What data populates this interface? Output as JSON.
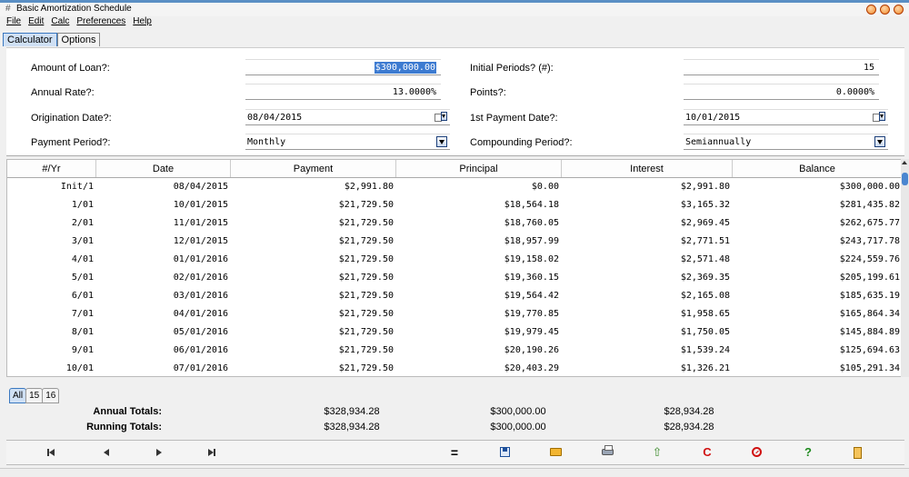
{
  "window": {
    "title": "Basic Amortization Schedule",
    "icon": "app-icon"
  },
  "menu": [
    "File",
    "Edit",
    "Calc",
    "Preferences",
    "Help"
  ],
  "tabs": [
    "Calculator",
    "Options"
  ],
  "form": {
    "amount_label": "Amount of Loan?:",
    "amount_value": "$300,000.00",
    "initial_periods_label": "Initial Periods? (#):",
    "initial_periods_value": "15",
    "annual_rate_label": "Annual Rate?:",
    "annual_rate_value": "13.0000%",
    "points_label": "Points?:",
    "points_value": "0.0000%",
    "origination_label": "Origination Date?:",
    "origination_value": "08/04/2015",
    "first_payment_label": "1st Payment Date?:",
    "first_payment_value": "10/01/2015",
    "payment_period_label": "Payment Period?:",
    "payment_period_value": "Monthly",
    "compounding_label": "Compounding Period?:",
    "compounding_value": "Semiannually"
  },
  "table": {
    "headers": [
      "#/Yr",
      "Date",
      "Payment",
      "Principal",
      "Interest",
      "Balance"
    ],
    "rows": [
      [
        "Init/1",
        "08/04/2015",
        "$2,991.80",
        "$0.00",
        "$2,991.80",
        "$300,000.00"
      ],
      [
        "1/01",
        "10/01/2015",
        "$21,729.50",
        "$18,564.18",
        "$3,165.32",
        "$281,435.82"
      ],
      [
        "2/01",
        "11/01/2015",
        "$21,729.50",
        "$18,760.05",
        "$2,969.45",
        "$262,675.77"
      ],
      [
        "3/01",
        "12/01/2015",
        "$21,729.50",
        "$18,957.99",
        "$2,771.51",
        "$243,717.78"
      ],
      [
        "4/01",
        "01/01/2016",
        "$21,729.50",
        "$19,158.02",
        "$2,571.48",
        "$224,559.76"
      ],
      [
        "5/01",
        "02/01/2016",
        "$21,729.50",
        "$19,360.15",
        "$2,369.35",
        "$205,199.61"
      ],
      [
        "6/01",
        "03/01/2016",
        "$21,729.50",
        "$19,564.42",
        "$2,165.08",
        "$185,635.19"
      ],
      [
        "7/01",
        "04/01/2016",
        "$21,729.50",
        "$19,770.85",
        "$1,958.65",
        "$165,864.34"
      ],
      [
        "8/01",
        "05/01/2016",
        "$21,729.50",
        "$19,979.45",
        "$1,750.05",
        "$145,884.89"
      ],
      [
        "9/01",
        "06/01/2016",
        "$21,729.50",
        "$20,190.26",
        "$1,539.24",
        "$125,694.63"
      ],
      [
        "10/01",
        "07/01/2016",
        "$21,729.50",
        "$20,403.29",
        "$1,326.21",
        "$105,291.34"
      ]
    ]
  },
  "page_tabs": [
    "All",
    "15",
    "16"
  ],
  "totals": {
    "annual_label": "Annual Totals:",
    "annual_payment": "$328,934.28",
    "annual_principal": "$300,000.00",
    "annual_interest": "$28,934.28",
    "running_label": "Running Totals:",
    "running_payment": "$328,934.28",
    "running_principal": "$300,000.00",
    "running_interest": "$28,934.28"
  },
  "toolbar": {
    "icons": [
      "first-icon",
      "prev-icon",
      "next-icon",
      "last-icon",
      "equals-icon",
      "save-icon",
      "open-icon",
      "print-icon",
      "export-icon",
      "reset-icon",
      "cancel-icon",
      "help-icon",
      "exit-icon"
    ],
    "equals_glyph": "=",
    "export_glyph": "⇧",
    "reset_glyph": "C",
    "help_glyph": "?"
  },
  "colors": {
    "accent": "#3d7bd1",
    "reset": "#d01010",
    "help": "#1f8a1f"
  }
}
